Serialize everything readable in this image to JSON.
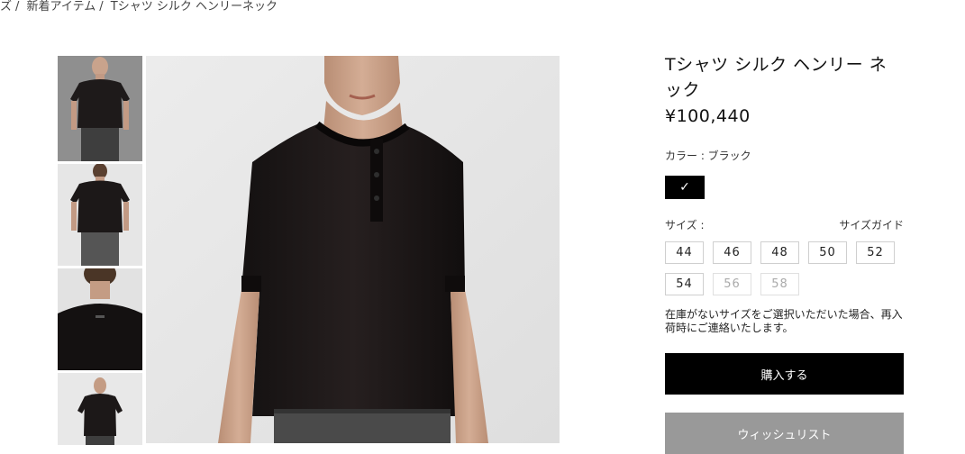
{
  "breadcrumb": {
    "items": [
      "ズ",
      "新着アイテム",
      "Tシャツ シルク ヘンリーネック"
    ],
    "separator": "/"
  },
  "product": {
    "title": "Tシャツ シルク ヘンリー ネック",
    "price": "¥100,440",
    "color_label": "カラー : ブラック",
    "selected_color": "#000000",
    "swatch_check": "✓",
    "size_label": "サイズ :",
    "size_guide": "サイズガイド",
    "sizes": [
      {
        "label": "44",
        "available": true
      },
      {
        "label": "46",
        "available": true
      },
      {
        "label": "48",
        "available": true
      },
      {
        "label": "50",
        "available": true
      },
      {
        "label": "52",
        "available": true
      },
      {
        "label": "54",
        "available": true
      },
      {
        "label": "56",
        "available": false
      },
      {
        "label": "58",
        "available": false
      }
    ],
    "notice": "在庫がないサイズをご選択いただいた場合、再入荷時にご連絡いたします。",
    "buy_label": "購入する",
    "wishlist_label": "ウィッシュリスト"
  }
}
